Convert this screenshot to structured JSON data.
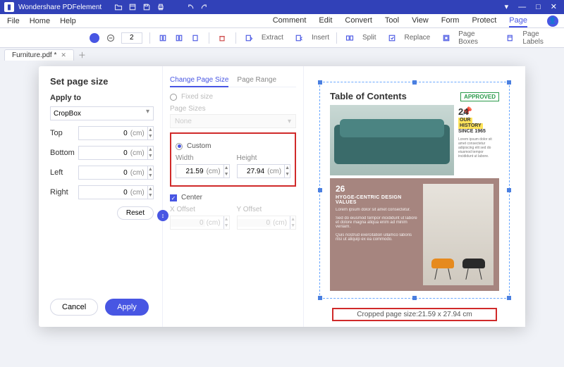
{
  "app": {
    "title": "Wondershare PDFelement"
  },
  "menu": {
    "file": "File",
    "home": "Home",
    "help": "Help",
    "tabs": [
      "Comment",
      "Edit",
      "Convert",
      "Tool",
      "View",
      "Form",
      "Protect",
      "Page"
    ],
    "active_tab": "Page"
  },
  "toolbar": {
    "page_value": "2",
    "extract": "Extract",
    "insert": "Insert",
    "split": "Split",
    "replace": "Replace",
    "page_boxes": "Page Boxes",
    "page_labels": "Page Labels"
  },
  "doc_tab": {
    "name": "Furniture.pdf *"
  },
  "dialog": {
    "title": "Set page size",
    "apply_to_label": "Apply to",
    "apply_to_value": "CropBox",
    "margins": {
      "top_label": "Top",
      "top": "0",
      "bottom_label": "Bottom",
      "bottom": "0",
      "left_label": "Left",
      "left": "0",
      "right_label": "Right",
      "right": "0",
      "unit": "(cm)"
    },
    "reset": "Reset",
    "cancel": "Cancel",
    "apply": "Apply",
    "mid": {
      "tab_change": "Change Page Size",
      "tab_range": "Page Range",
      "fixed": "Fixed size",
      "page_sizes_label": "Page Sizes",
      "page_sizes_value": "None",
      "custom": "Custom",
      "width_label": "Width",
      "width": "21.59",
      "height_label": "Height",
      "height": "27.94",
      "unit": "(cm)",
      "center": "Center",
      "xoffset_label": "X Offset",
      "xoffset": "0",
      "yoffset_label": "Y Offset",
      "yoffset": "0"
    },
    "preview": {
      "toc_title": "Table of Contents",
      "approved": "APPROVED",
      "s1_num": "24",
      "s1_l1": "OUR",
      "s1_l2": "HISTORY",
      "s1_l3": "SINCE 1965",
      "s2_num": "26",
      "s2_head": "HYGGE-CENTRIC DESIGN VALUES",
      "crop_info": "Cropped page size:21.59 x 27.94 cm"
    }
  },
  "chart_data": null
}
